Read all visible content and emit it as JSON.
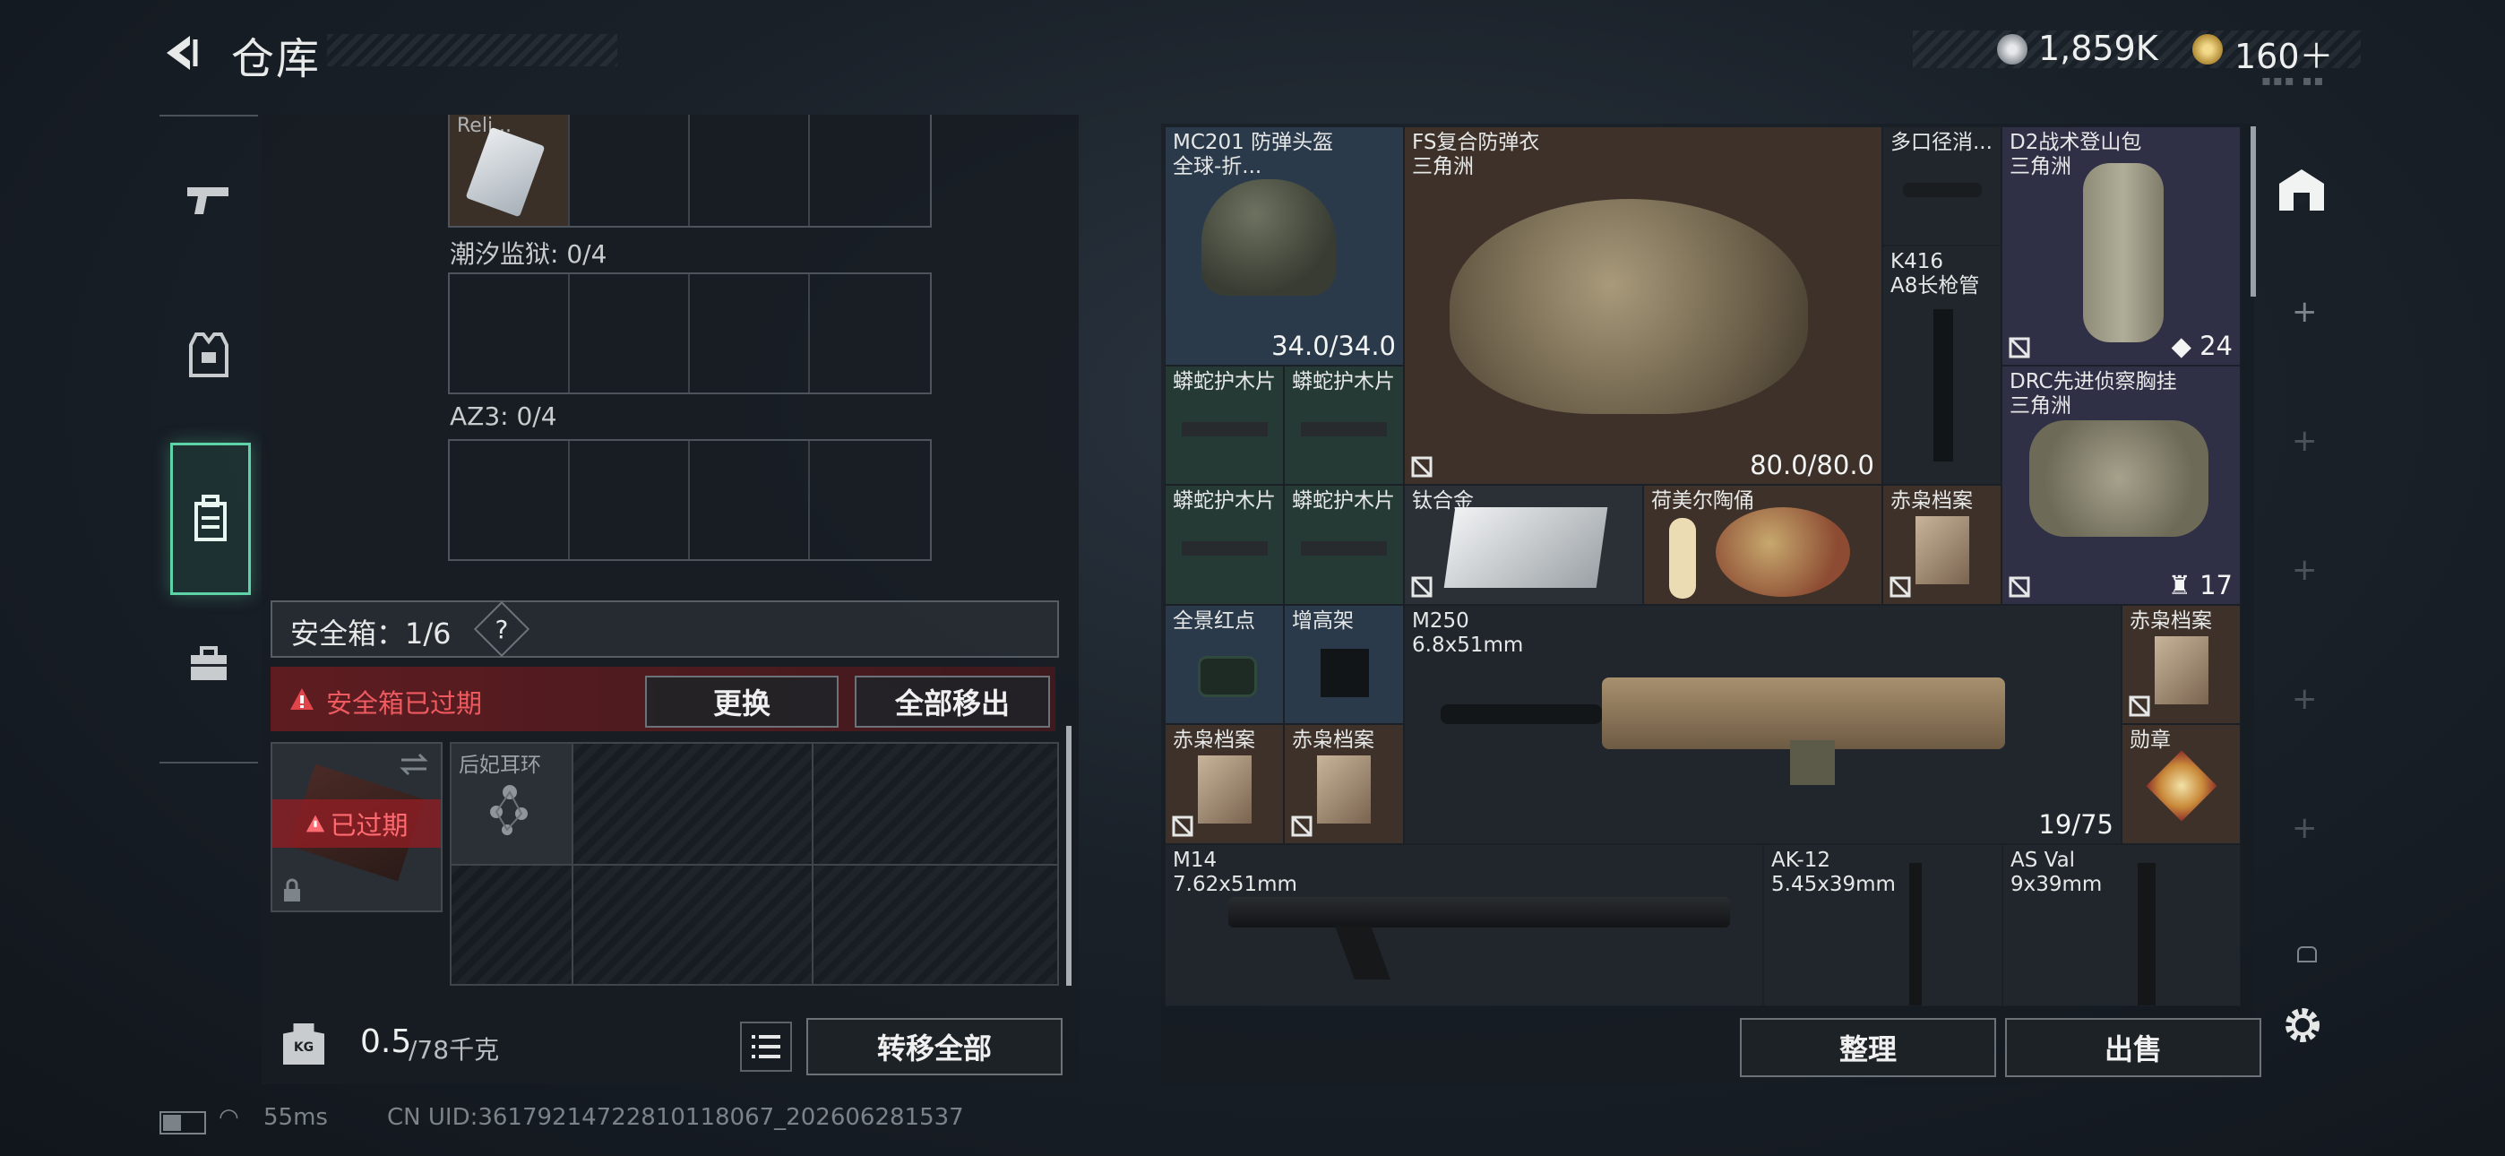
{
  "header": {
    "title": "仓库",
    "currency_silver": "1,859K",
    "currency_gold": "160＋"
  },
  "left": {
    "partial_item_label": "Reli...",
    "section1_label": "潮汐监狱: 0/4",
    "section2_label": "AZ3: 0/4",
    "safebox_label": "安全箱：1/6",
    "safebox_help": "?",
    "expired_notice": "安全箱已过期",
    "replace_button": "更换",
    "remove_all_button": "全部移出",
    "case_expired_tag": "已过期",
    "case_item_name": "后妃耳环",
    "weight_value": "0.5",
    "weight_max": "/78千克",
    "weight_badge": "KG",
    "transfer_all_button": "转移全部"
  },
  "right": {
    "items": [
      {
        "name": "MC201 防弹头盔",
        "sub": "全球-折...",
        "value": "34.0/34.0"
      },
      {
        "name": "FS复合防弹衣",
        "sub": "三角洲",
        "value": "80.0/80.0"
      },
      {
        "name": "多口径消...",
        "sub": ""
      },
      {
        "name": "D2战术登山包",
        "sub": "三角洲",
        "value": "24"
      },
      {
        "name": "K416",
        "sub": "A8长枪管"
      },
      {
        "name": "DRC先进侦察胸挂",
        "sub": "三角洲",
        "value": "17"
      },
      {
        "name": "蟒蛇护木片"
      },
      {
        "name": "蟒蛇护木片"
      },
      {
        "name": "蟒蛇护木片"
      },
      {
        "name": "蟒蛇护木片"
      },
      {
        "name": "钛合金"
      },
      {
        "name": "荷美尔陶俑"
      },
      {
        "name": "赤枭档案"
      },
      {
        "name": "全景红点"
      },
      {
        "name": "增高架"
      },
      {
        "name": "M250",
        "sub": "6.8x51mm",
        "value": "19/75"
      },
      {
        "name": "赤枭档案"
      },
      {
        "name": "赤枭档案"
      },
      {
        "name": "赤枭档案"
      },
      {
        "name": "勋章"
      },
      {
        "name": "M14",
        "sub": "7.62x51mm"
      },
      {
        "name": "AK-12",
        "sub": "5.45x39mm"
      },
      {
        "name": "AS Val",
        "sub": "9x39mm"
      }
    ],
    "sort_button": "整理",
    "sell_button": "出售"
  },
  "status": {
    "ping": "55ms",
    "uid": "CN UID:36179214722810118067_202606281537"
  },
  "colors": {
    "accent_green": "#5fd3a8",
    "alert_red": "#e0454b"
  }
}
